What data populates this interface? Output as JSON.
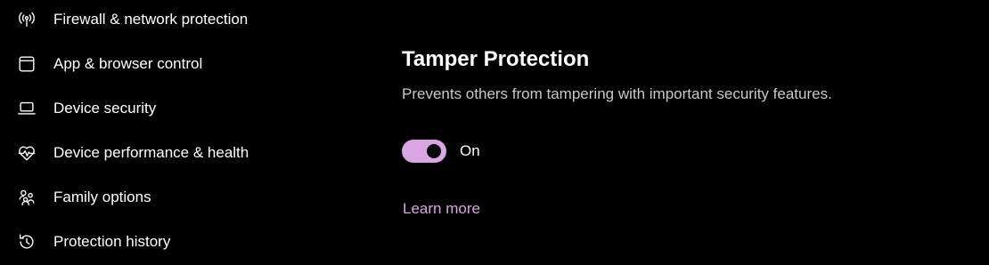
{
  "sidebar": {
    "items": [
      {
        "label": "Firewall & network protection",
        "icon": "wifi-antenna-icon"
      },
      {
        "label": "App & browser control",
        "icon": "browser-window-icon"
      },
      {
        "label": "Device security",
        "icon": "laptop-icon"
      },
      {
        "label": "Device performance & health",
        "icon": "heart-pulse-icon"
      },
      {
        "label": "Family options",
        "icon": "family-icon"
      },
      {
        "label": "Protection history",
        "icon": "history-icon"
      }
    ]
  },
  "main": {
    "title": "Tamper Protection",
    "description": "Prevents others from tampering with important security features.",
    "toggle": {
      "state": "on",
      "label": "On"
    },
    "learn_more": "Learn more"
  },
  "colors": {
    "background": "#000000",
    "text": "#ffffff",
    "muted_text": "#c8c8c8",
    "accent": "#d9a5e3"
  }
}
